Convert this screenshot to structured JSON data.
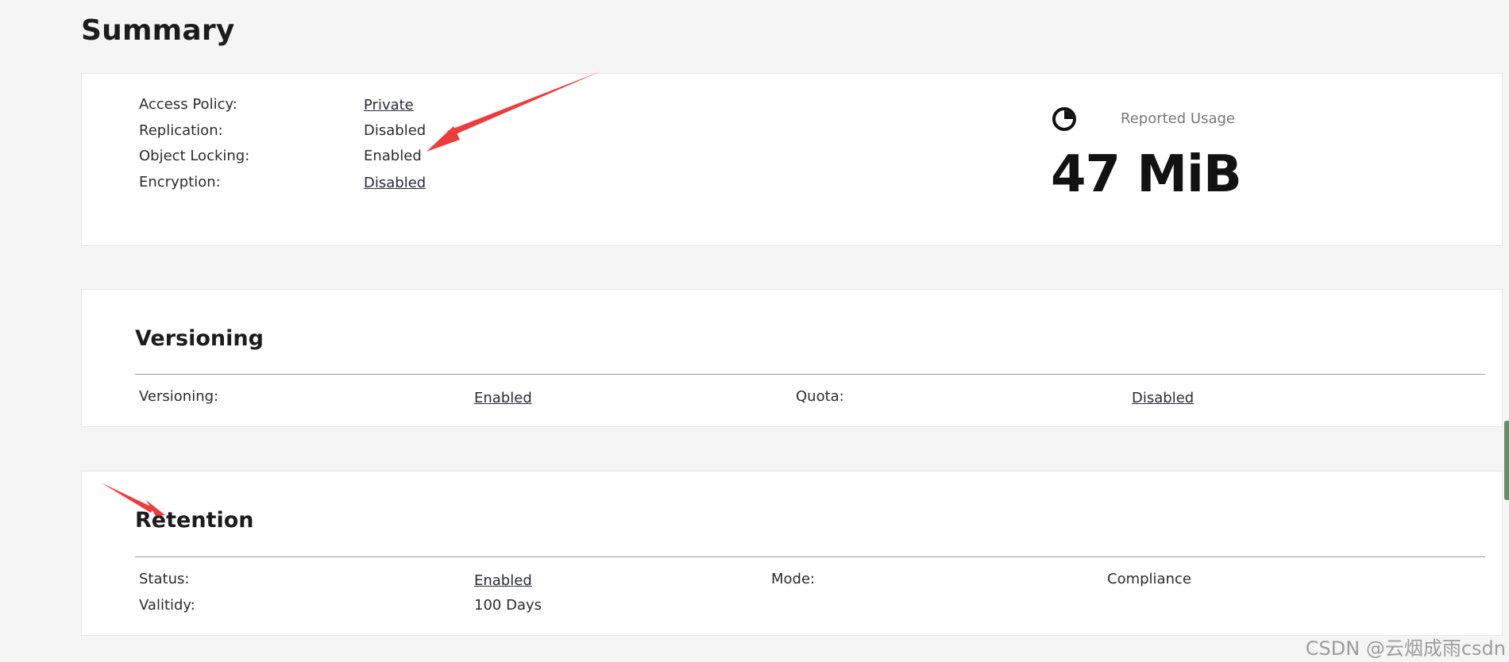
{
  "page": {
    "title": "Summary"
  },
  "summary": {
    "rows": [
      {
        "label": "Access Policy:",
        "value": "Private",
        "link": true
      },
      {
        "label": "Replication:",
        "value": "Disabled",
        "link": false
      },
      {
        "label": "Object Locking:",
        "value": "Enabled",
        "link": false
      },
      {
        "label": "Encryption:",
        "value": "Disabled",
        "link": true
      }
    ],
    "usage": {
      "label": "Reported Usage",
      "value": "47 MiB",
      "icon": "pie-chart-icon"
    }
  },
  "versioning": {
    "title": "Versioning",
    "fields": [
      {
        "label": "Versioning:",
        "value": "Enabled",
        "link": true
      },
      {
        "label": "Quota:",
        "value": "Disabled",
        "link": true
      }
    ]
  },
  "retention": {
    "title": "Retention",
    "fields": [
      {
        "label": "Status:",
        "value": "Enabled",
        "link": true
      },
      {
        "label": "Mode:",
        "value": "Compliance",
        "link": false
      },
      {
        "label": "Valitidy:",
        "value": "100 Days",
        "link": false
      }
    ]
  },
  "watermark": {
    "text": "CSDN @云烟成雨csdn"
  },
  "colors": {
    "background": "#f5f5f5",
    "panel": "#ffffff",
    "annotation": "#ee3b3b",
    "link": "#2a2a3a"
  }
}
